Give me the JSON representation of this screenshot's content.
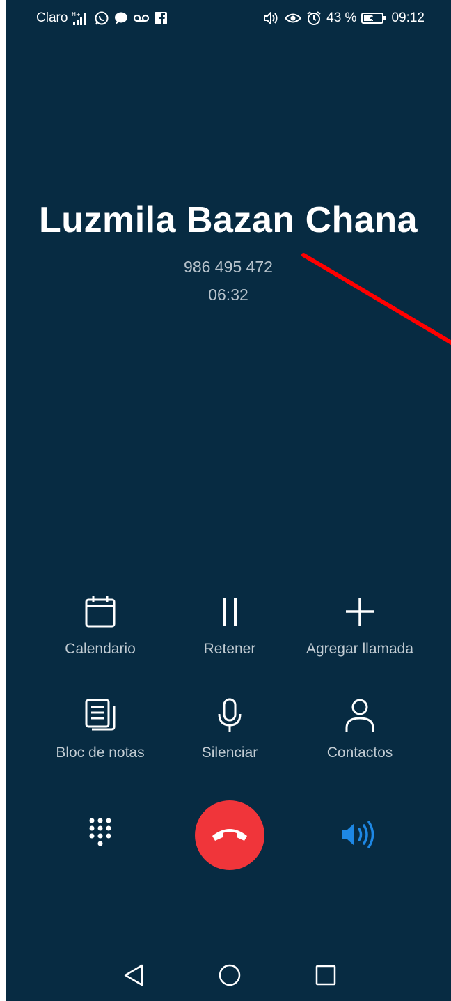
{
  "status_bar": {
    "carrier": "Claro",
    "battery_percent": "43 %",
    "time": "09:12",
    "icons_left": [
      "signal-icon",
      "whatsapp-icon",
      "chat-bubble-icon",
      "voicemail-icon",
      "facebook-icon"
    ],
    "icons_right": [
      "speaker-volume-icon",
      "eye-icon",
      "alarm-icon",
      "battery-icon"
    ]
  },
  "call": {
    "caller_name": "Luzmila Bazan Chana",
    "phone_number": "986 495 472",
    "duration": "06:32"
  },
  "actions": {
    "calendar": "Calendario",
    "hold": "Retener",
    "add_call": "Agregar llamada",
    "notepad": "Bloc de notas",
    "mute": "Silenciar",
    "contacts": "Contactos"
  },
  "controls": {
    "end_call_color": "#f0353a",
    "speaker_color": "#1e88e5",
    "background_color": "#072b42"
  },
  "annotation": {
    "color": "#ff0000"
  }
}
